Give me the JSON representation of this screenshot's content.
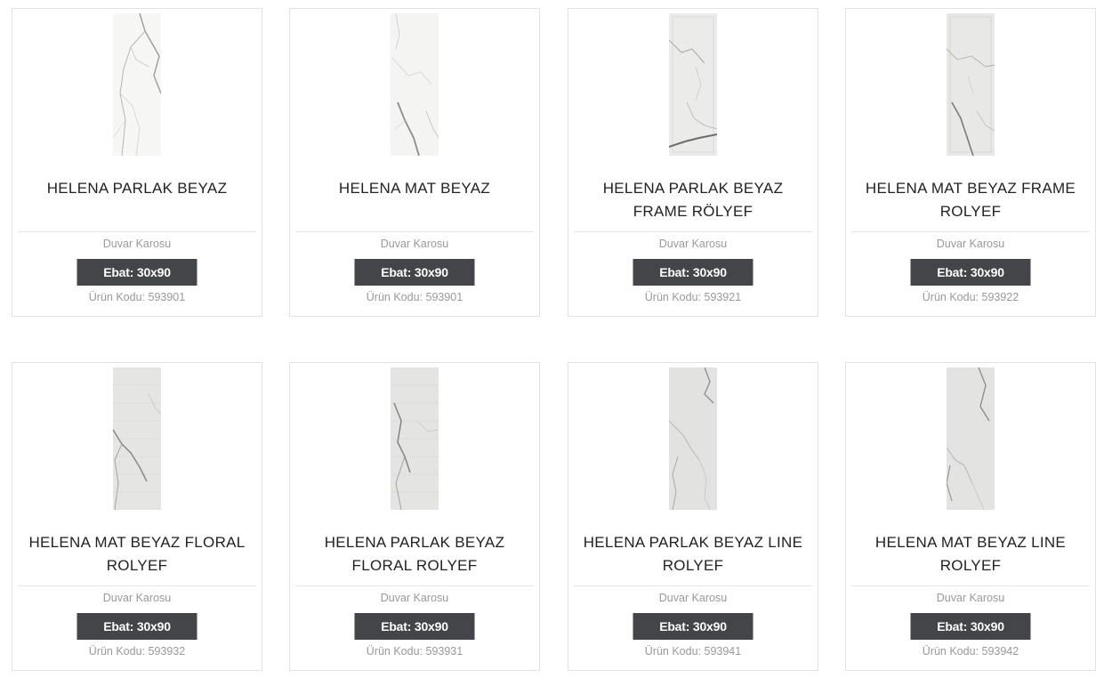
{
  "products": [
    {
      "title": "HELENA PARLAK BEYAZ",
      "category": "Duvar Karosu",
      "size": "Ebat: 30x90",
      "code": "Ürün Kodu: 593901",
      "thumb": "white-marble-glossy"
    },
    {
      "title": "HELENA MAT BEYAZ",
      "category": "Duvar Karosu",
      "size": "Ebat: 30x90",
      "code": "Ürün Kodu: 593901",
      "thumb": "white-marble-matte"
    },
    {
      "title": "HELENA PARLAK BEYAZ FRAME RÖLYEF",
      "category": "Duvar Karosu",
      "size": "Ebat: 30x90",
      "code": "Ürün Kodu: 593921",
      "thumb": "white-marble-frame"
    },
    {
      "title": "HELENA MAT BEYAZ FRAME ROLYEF",
      "category": "Duvar Karosu",
      "size": "Ebat: 30x90",
      "code": "Ürün Kodu: 593922",
      "thumb": "white-marble-frame"
    },
    {
      "title": "HELENA MAT BEYAZ FLORAL ROLYEF",
      "category": "Duvar Karosu",
      "size": "Ebat: 30x90",
      "code": "Ürün Kodu: 593932",
      "thumb": "white-marble-floral"
    },
    {
      "title": "HELENA PARLAK BEYAZ FLORAL ROLYEF",
      "category": "Duvar Karosu",
      "size": "Ebat: 30x90",
      "code": "Ürün Kodu: 593931",
      "thumb": "white-marble-floral"
    },
    {
      "title": "HELENA PARLAK BEYAZ LINE ROLYEF",
      "category": "Duvar Karosu",
      "size": "Ebat: 30x90",
      "code": "Ürün Kodu: 593941",
      "thumb": "white-marble-line"
    },
    {
      "title": "HELENA MAT BEYAZ LINE ROLYEF",
      "category": "Duvar Karosu",
      "size": "Ebat: 30x90",
      "code": "Ürün Kodu: 593942",
      "thumb": "white-marble-line"
    }
  ],
  "colors": {
    "badge_bg": "#444548",
    "badge_text": "#ffffff",
    "muted_text": "#999999",
    "card_border": "#e2e2e2"
  }
}
